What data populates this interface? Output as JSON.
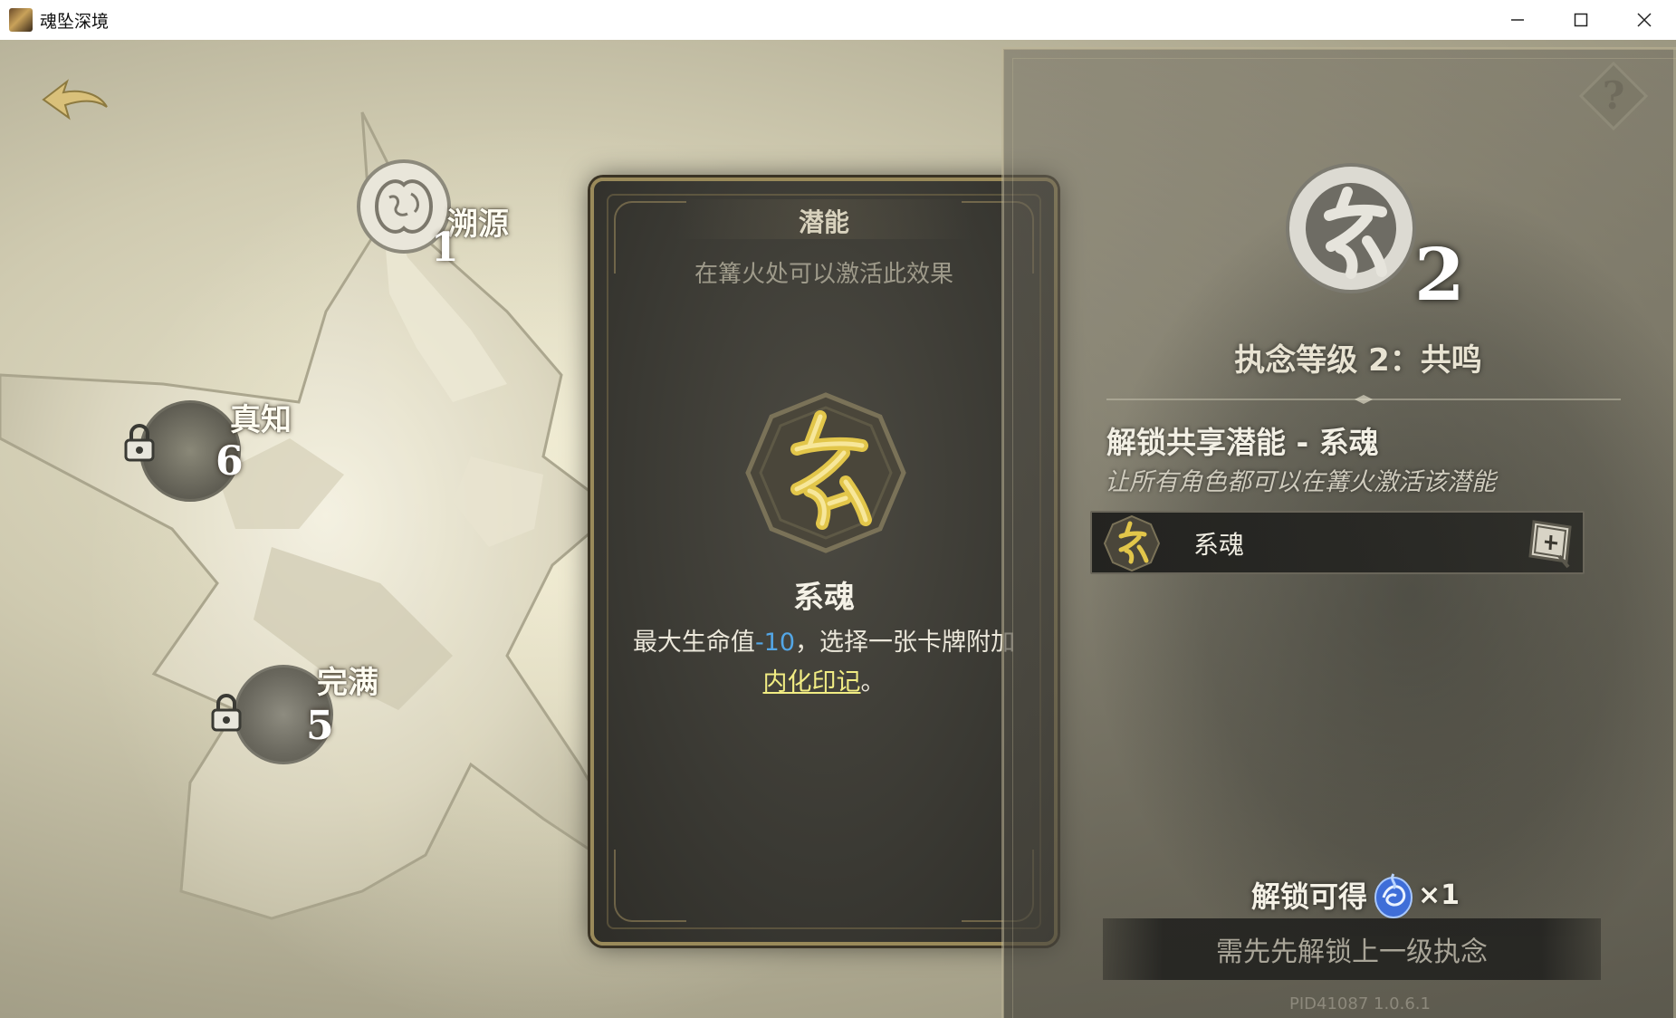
{
  "window": {
    "title": "魂坠深境"
  },
  "skill_tree": {
    "nodes": [
      {
        "name": "溯源",
        "level": "1"
      },
      {
        "name": "真知",
        "level": "6"
      },
      {
        "name": "完满",
        "level": "5"
      }
    ]
  },
  "card": {
    "title": "潜能",
    "subtitle": "在篝火处可以激活此效果",
    "skill_name": "系魂",
    "desc_prefix": "最大生命值",
    "desc_value": "-10",
    "desc_middle": "，选择一张卡牌附加",
    "desc_keyword": "内化印记",
    "desc_suffix": "。"
  },
  "panel": {
    "level_number": "2",
    "level_title": "执念等级 2：共鸣",
    "unlock_title": "解锁共享潜能 - 系魂",
    "unlock_description": "让所有角色都可以在篝火激活该潜能",
    "skill_row_name": "系魂",
    "reward_label": "解锁可得",
    "reward_count": "×1",
    "unlock_button_label": "需先先解锁上一级执念"
  },
  "footer": {
    "version": "PID41087 1.0.6.1"
  },
  "colors": {
    "accent_gold": "#e2c64a",
    "value_blue": "#53a6e6",
    "keyword_yellow": "#f1ec83"
  },
  "icons": [
    "back-arrow-icon",
    "help-icon",
    "lock-icon",
    "soul-bind-icon",
    "tree-node-icon",
    "soul-crystal-icon",
    "inspect-icon"
  ]
}
